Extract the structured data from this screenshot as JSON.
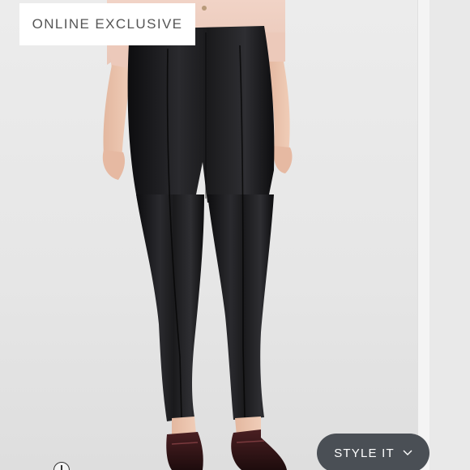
{
  "badge": {
    "label": "ONLINE EXCLUSIVE"
  },
  "style_button": {
    "label": "STYLE IT",
    "icon": "chevron-down-icon"
  },
  "zoom": {
    "icon": "zoom-icon"
  },
  "colors": {
    "background": "#eeeeee",
    "badge_bg": "#ffffff",
    "badge_text": "#555555",
    "button_bg": "#4a4f55",
    "button_text": "#ffffff",
    "leggings": "#1b1b1d",
    "sweater": "#efcfc0"
  }
}
